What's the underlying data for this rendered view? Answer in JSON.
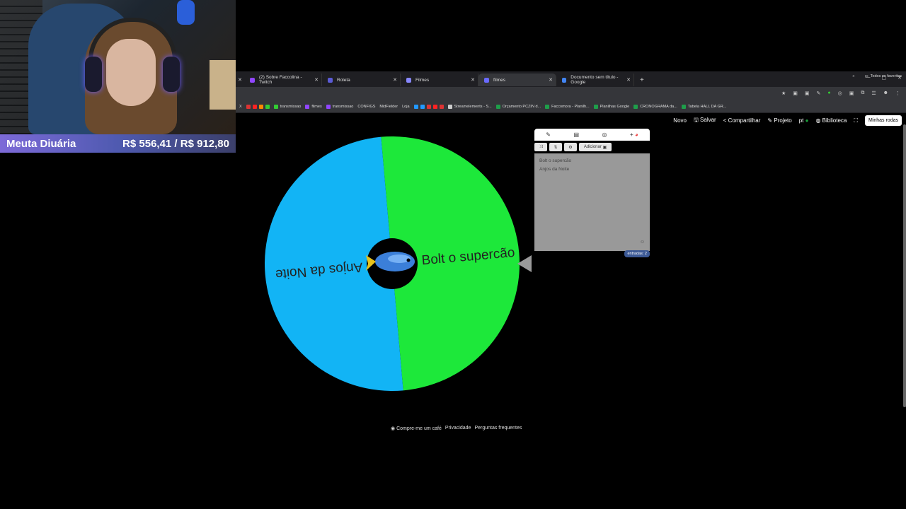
{
  "stream": {
    "donation_label": "Meuta Diuária",
    "donation_value": "R$ 556,41 / R$ 912,80"
  },
  "browser": {
    "tabs": [
      {
        "label": "(2) Sobre Faccolina - Twitch",
        "color": "#9146ff"
      },
      {
        "label": "Roleta",
        "color": "#5b5bd6"
      },
      {
        "label": "Filmes",
        "color": "#8888ff"
      },
      {
        "label": "filmes",
        "color": "#6a6aff",
        "active": true
      },
      {
        "label": "Documento sem título - Google",
        "color": "#4285f4"
      }
    ],
    "new_tab": "+",
    "bookmarks": [
      "transmissao",
      "filmes",
      "transmissao",
      "CONFIGS",
      "MidFielder",
      "Loja",
      "Streamelements - S...",
      "Orçamento PCZIN d...",
      "Faccomora - Planilh...",
      "Planilhas Google",
      "CRONOGRAMA da...",
      "Tabela HALL DA GR..."
    ],
    "bookmarks_all": "Todos os favoritos"
  },
  "toolbar": {
    "new": "Novo",
    "save": "Salvar",
    "share": "Compartilhar",
    "project": "Projeto",
    "lang": "pt",
    "library": "Biblioteca",
    "my_wheels": "Minhas rodas"
  },
  "wheel": {
    "segments": [
      {
        "label": "Bolt o supercão",
        "color": "#1de83a"
      },
      {
        "label": "Anjos da Noite",
        "color": "#12b4f5"
      }
    ],
    "pointer_color": "#9a9a9a"
  },
  "editor": {
    "add_button": "Adicionar",
    "entries": [
      "Bolt o supercão",
      "Anjos da Noite"
    ],
    "count": "entradas: 2"
  },
  "footer": {
    "coffee": "Compre-me um café",
    "privacy": "Privacidade",
    "faq": "Perguntas frequentes"
  }
}
